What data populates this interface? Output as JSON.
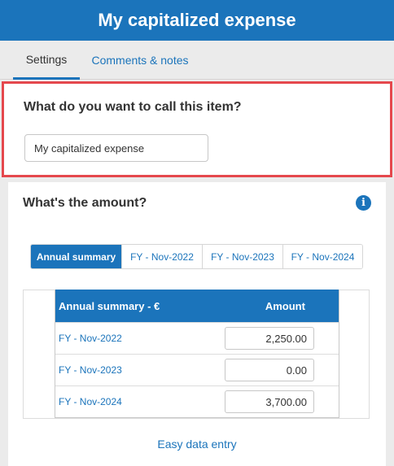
{
  "header": {
    "title": "My capitalized expense"
  },
  "tabs": [
    {
      "label": "Settings"
    },
    {
      "label": "Comments & notes"
    }
  ],
  "name_section": {
    "question": "What do you want to call this item?",
    "value": "My capitalized expense"
  },
  "amount_section": {
    "question": "What's the amount?",
    "info_icon": "info-icon",
    "segments": [
      {
        "label": "Annual summary"
      },
      {
        "label": "FY - Nov-2022"
      },
      {
        "label": "FY - Nov-2023"
      },
      {
        "label": "FY - Nov-2024"
      }
    ],
    "table": {
      "headers": {
        "label": "Annual summary - €",
        "amount": "Amount"
      },
      "rows": [
        {
          "label": "FY - Nov-2022",
          "value": "2,250.00"
        },
        {
          "label": "FY - Nov-2023",
          "value": "0.00"
        },
        {
          "label": "FY - Nov-2024",
          "value": "3,700.00"
        }
      ]
    },
    "easy_entry_label": "Easy data entry"
  },
  "colors": {
    "accent": "#1b74bb",
    "highlight_border": "#e5484d"
  }
}
